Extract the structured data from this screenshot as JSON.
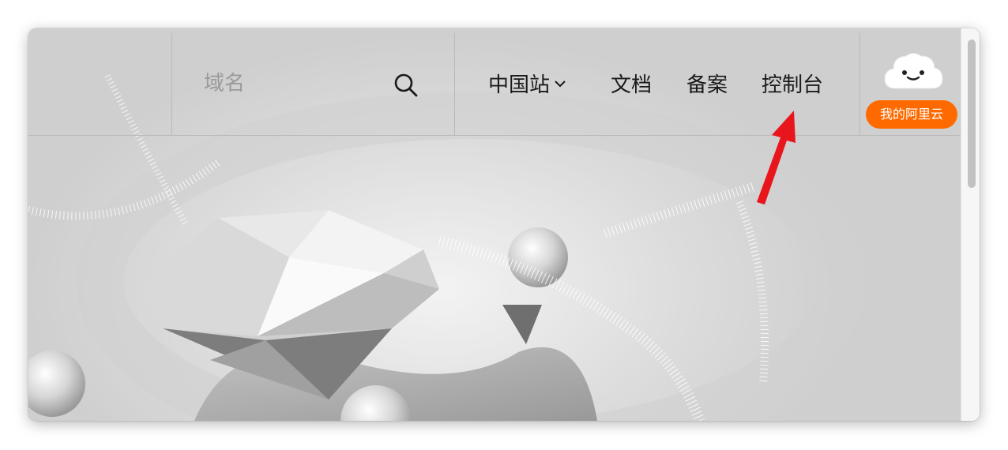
{
  "search": {
    "placeholder": "域名",
    "icon": "search-icon"
  },
  "nav": {
    "items": [
      {
        "label": "中国站",
        "has_dropdown": true
      },
      {
        "label": "文档"
      },
      {
        "label": "备案"
      },
      {
        "label": "控制台"
      }
    ]
  },
  "user": {
    "avatar_icon": "cloud-face-icon",
    "badge_label": "我的阿里云",
    "badge_color": "#ff6a00"
  },
  "annotation": {
    "arrow_color": "#e8161c",
    "points_to": "控制台"
  }
}
